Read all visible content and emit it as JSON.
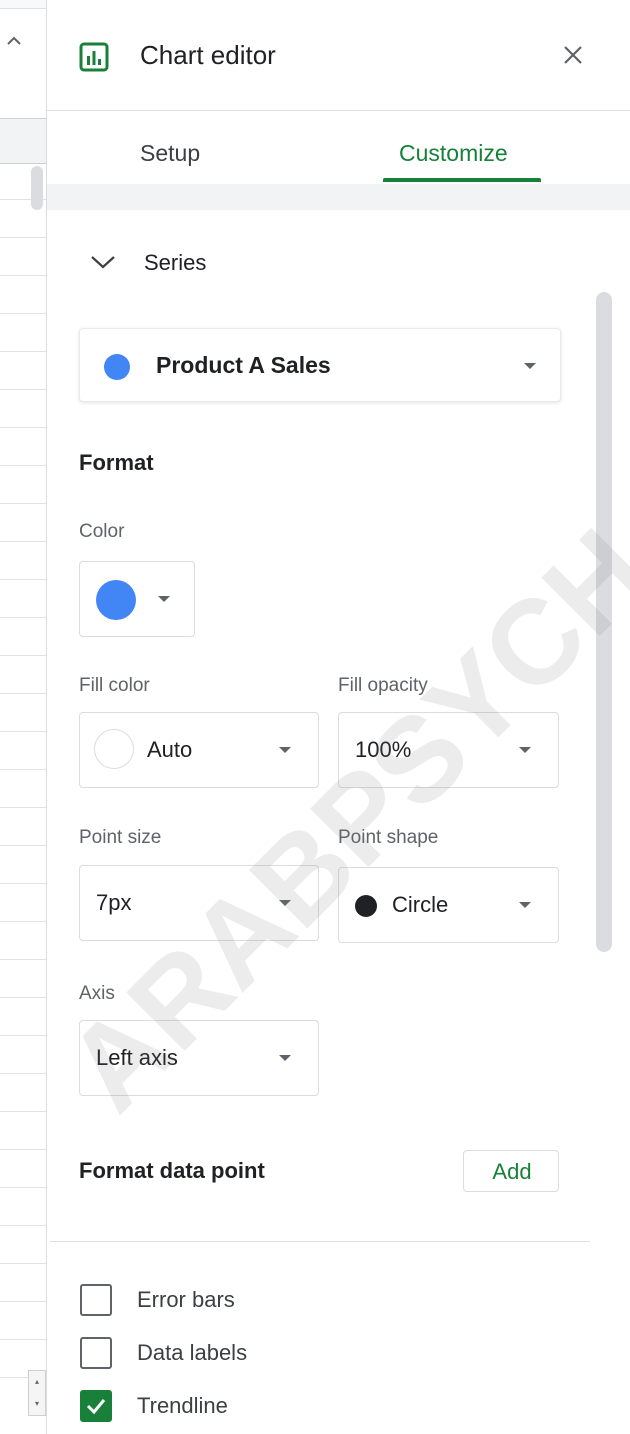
{
  "header": {
    "title": "Chart editor"
  },
  "tabs": [
    {
      "label": "Setup",
      "active": false
    },
    {
      "label": "Customize",
      "active": true
    }
  ],
  "series_section": {
    "label": "Series",
    "selected_series": "Product A Sales",
    "series_color": "#4285f4"
  },
  "format": {
    "heading": "Format",
    "color_label": "Color",
    "color_value": "#4285f4",
    "fill_color_label": "Fill color",
    "fill_color_value": "Auto",
    "fill_opacity_label": "Fill opacity",
    "fill_opacity_value": "100%",
    "point_size_label": "Point size",
    "point_size_value": "7px",
    "point_shape_label": "Point shape",
    "point_shape_value": "Circle",
    "axis_label": "Axis",
    "axis_value": "Left axis"
  },
  "format_data_point": {
    "label": "Format data point",
    "add_label": "Add"
  },
  "options": [
    {
      "label": "Error bars",
      "checked": false
    },
    {
      "label": "Data labels",
      "checked": false
    },
    {
      "label": "Trendline",
      "checked": true
    }
  ],
  "watermark": "ARABPSYCH",
  "colors": {
    "accent_green": "#188038",
    "series_blue": "#4285f4"
  }
}
